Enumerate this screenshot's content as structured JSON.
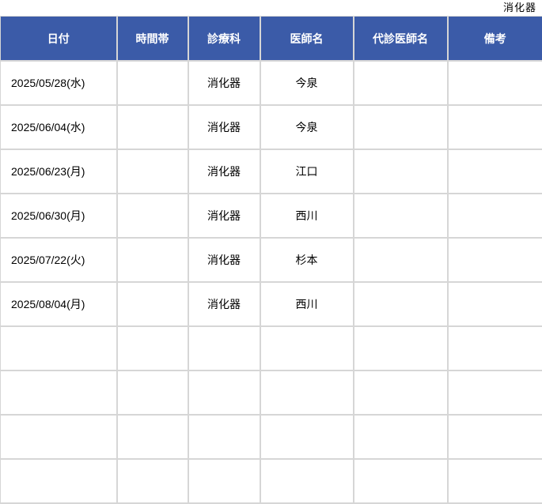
{
  "corner_label": "消化器",
  "columns": [
    "日付",
    "時間帯",
    "診療科",
    "医師名",
    "代診医師名",
    "備考"
  ],
  "rows": [
    {
      "date": "2025/05/28(水)",
      "time": "",
      "dept": "消化器",
      "doctor": "今泉",
      "substitute": "",
      "note": ""
    },
    {
      "date": "2025/06/04(水)",
      "time": "",
      "dept": "消化器",
      "doctor": "今泉",
      "substitute": "",
      "note": ""
    },
    {
      "date": "2025/06/23(月)",
      "time": "",
      "dept": "消化器",
      "doctor": "江口",
      "substitute": "",
      "note": ""
    },
    {
      "date": "2025/06/30(月)",
      "time": "",
      "dept": "消化器",
      "doctor": "西川",
      "substitute": "",
      "note": ""
    },
    {
      "date": "2025/07/22(火)",
      "time": "",
      "dept": "消化器",
      "doctor": "杉本",
      "substitute": "",
      "note": ""
    },
    {
      "date": "2025/08/04(月)",
      "time": "",
      "dept": "消化器",
      "doctor": "西川",
      "substitute": "",
      "note": ""
    },
    {
      "date": "",
      "time": "",
      "dept": "",
      "doctor": "",
      "substitute": "",
      "note": ""
    },
    {
      "date": "",
      "time": "",
      "dept": "",
      "doctor": "",
      "substitute": "",
      "note": ""
    },
    {
      "date": "",
      "time": "",
      "dept": "",
      "doctor": "",
      "substitute": "",
      "note": ""
    },
    {
      "date": "",
      "time": "",
      "dept": "",
      "doctor": "",
      "substitute": "",
      "note": ""
    }
  ],
  "colors": {
    "header_bg": "#3b5ba8",
    "header_text": "#ffffff",
    "grid": "#d6d6d6"
  }
}
